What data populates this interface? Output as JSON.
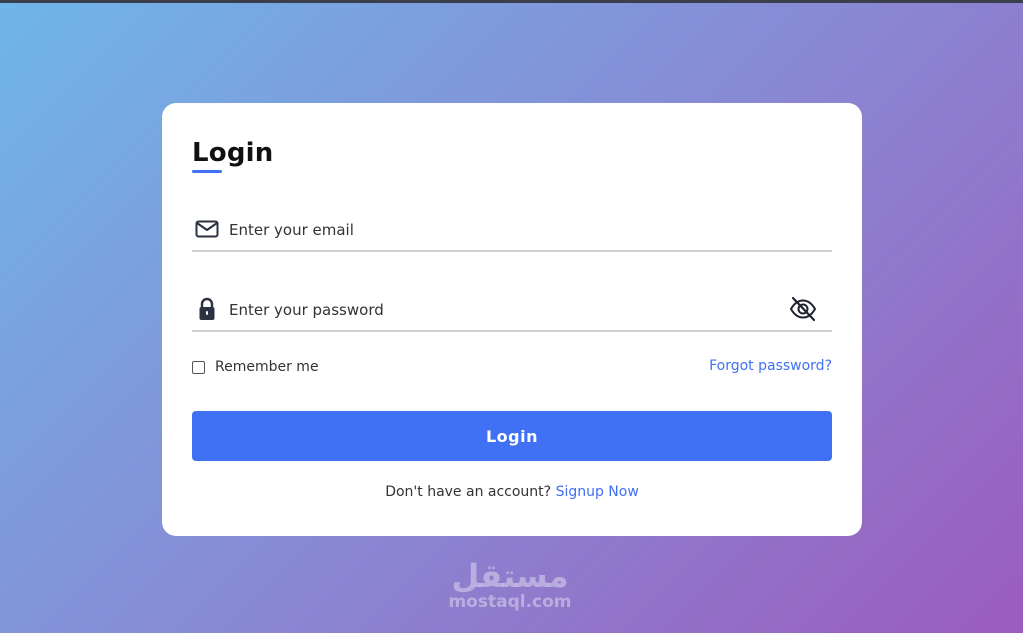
{
  "page": {
    "background_from": "#6fb6e8",
    "background_to": "#9b5cbd"
  },
  "form": {
    "title": "Login",
    "accent_color": "#4070f4",
    "email": {
      "icon": "envelope-icon",
      "placeholder": "Enter your email",
      "value": ""
    },
    "password": {
      "icon": "lock-icon",
      "placeholder": "Enter your password",
      "value": "",
      "toggle_icon": "eye-slash-icon"
    },
    "remember_label": "Remember me",
    "remember_checked": false,
    "forgot_label": "Forgot password?",
    "submit_label": "Login",
    "signup_prompt": "Don't have an account?",
    "signup_link": "Signup Now"
  },
  "watermark": {
    "arabic": "مستقل",
    "latin": "mostaql.com"
  }
}
